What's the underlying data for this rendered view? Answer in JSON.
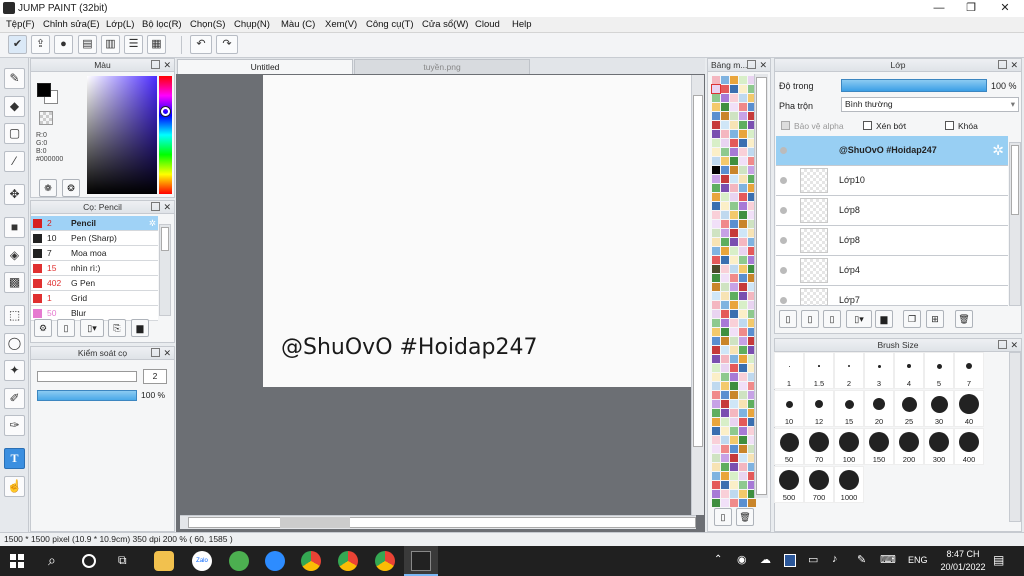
{
  "window": {
    "title": "JUMP PAINT (32bit)",
    "minimize": "—",
    "restore": "❐",
    "close": "✕"
  },
  "menu": [
    "Tệp(F)",
    "Chỉnh sửa(E)",
    "Lớp(L)",
    "Bộ lọc(R)",
    "Chọn(S)",
    "Chụp(N)",
    "Màu (C)",
    "Xem(V)",
    "Công cụ(T)",
    "Cửa sổ(W)",
    "Cloud",
    "Help"
  ],
  "color_panel": {
    "title": "Màu",
    "r": "R:0",
    "g": "G:0",
    "b": "B:0",
    "hex": "#000000",
    "fg": "#000000",
    "bg": "#ffffff"
  },
  "brush_panel": {
    "title": "Cọ: Pencil",
    "items": [
      {
        "size": "2",
        "name": "Pencil",
        "color": "#d62020",
        "selected": true
      },
      {
        "size": "10",
        "name": "Pen (Sharp)",
        "color": "#222222",
        "selected": false
      },
      {
        "size": "7",
        "name": "Moa moa",
        "color": "#222222",
        "selected": false
      },
      {
        "size": "15",
        "name": "nhìn rì:)",
        "color": "#e03030",
        "selected": false
      },
      {
        "size": "402",
        "name": "G Pen",
        "color": "#e03030",
        "selected": false
      },
      {
        "size": "1",
        "name": "Grid",
        "color": "#e03030",
        "selected": false
      },
      {
        "size": "50",
        "name": "Blur",
        "color": "#e67ad0",
        "selected": false
      }
    ]
  },
  "brush_control": {
    "title": "Kiểm soát cọ",
    "size": "2",
    "opacity": "100 %"
  },
  "tabs": {
    "active": "Untitled",
    "other": "tuyền.png"
  },
  "canvas": {
    "text": "@ShuOvO #Hoidap247"
  },
  "palette_panel": {
    "title": "Bảng m..."
  },
  "layer_panel": {
    "title": "Lớp",
    "opacity_label": "Độ trong",
    "opacity_value": "100 %",
    "blend_label": "Pha trộn",
    "blend_value": "Bình thường",
    "protect_alpha": "Bảo vệ alpha",
    "clipping": "Xén bớt",
    "lock": "Khóa",
    "layers": [
      "@ShuOvO #Hoidap247",
      "Lớp10",
      "Lớp8",
      "Lớp8",
      "Lớp4",
      "Lớp7"
    ]
  },
  "brush_size": {
    "title": "Brush Size",
    "sizes": [
      "1",
      "1.5",
      "2",
      "3",
      "4",
      "5",
      "7",
      "10",
      "12",
      "15",
      "20",
      "25",
      "30",
      "40",
      "50",
      "70",
      "100",
      "150",
      "200",
      "300",
      "400",
      "500",
      "700",
      "1000"
    ]
  },
  "status": {
    "text": "1500 * 1500 pixel   (10.9 * 10.9cm)   350 dpi   200 %   ( 60, 1585 )"
  },
  "taskbar": {
    "lang": "ENG",
    "time": "8:47 CH",
    "date": "20/01/2022"
  }
}
